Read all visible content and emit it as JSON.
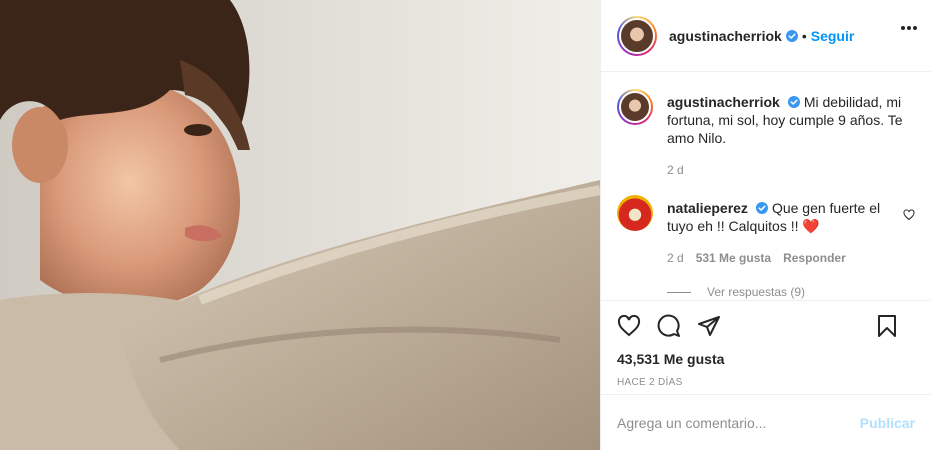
{
  "post": {
    "author": "agustinacherriok",
    "follow_label": "Seguir",
    "dot": "•",
    "caption": "Mi debilidad, mi fortuna, mi sol, hoy cumple 9 años. Te amo Nilo.",
    "caption_time": "2 d",
    "likes": "43,531 Me gusta",
    "posted_ago": "HACE 2 DÍAS"
  },
  "comments": [
    {
      "user": "natalieperez",
      "text": "Que gen fuerte el tuyo eh !! Calquitos !!",
      "emoji": "❤️",
      "time": "2 d",
      "likes": "531 Me gusta",
      "reply_label": "Responder",
      "view_replies": "Ver respuestas (9)"
    }
  ],
  "compose": {
    "placeholder": "Agrega un comentario...",
    "publish_label": "Publicar"
  },
  "colors": {
    "accent": "#0095f6",
    "publish_disabled": "#b2dffc",
    "verified": "#3897f0",
    "heart": "#ed4956"
  },
  "icons": [
    "verified-icon",
    "more-options-icon",
    "heart-icon",
    "comment-icon",
    "share-icon",
    "bookmark-icon",
    "heart-outline-small-icon"
  ]
}
